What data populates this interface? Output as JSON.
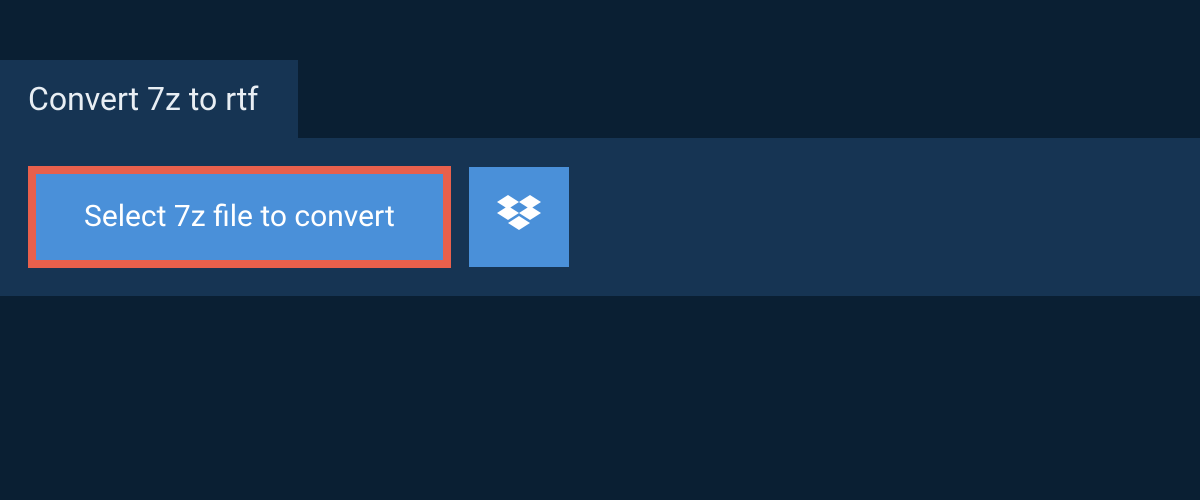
{
  "header": {
    "title": "Convert 7z to rtf"
  },
  "actions": {
    "select_file_label": "Select 7z file to convert"
  }
}
